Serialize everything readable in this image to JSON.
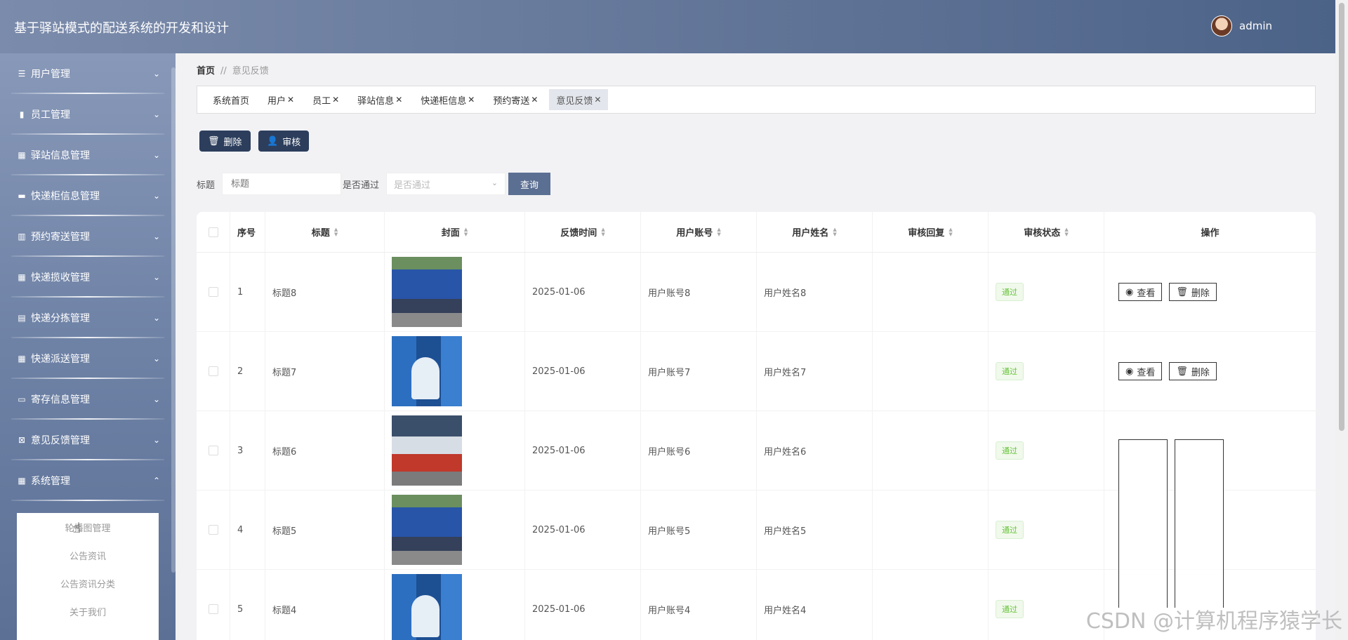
{
  "header": {
    "title": "基于驿站模式的配送系统的开发和设计",
    "username": "admin"
  },
  "sidebar": {
    "items": [
      {
        "label": "用户管理",
        "icon": "list-icon",
        "glyph": "☰",
        "chev": "⌄"
      },
      {
        "label": "员工管理",
        "icon": "clipboard-icon",
        "glyph": "▮",
        "chev": "⌄"
      },
      {
        "label": "驿站信息管理",
        "icon": "grid-icon",
        "glyph": "▦",
        "chev": "⌄"
      },
      {
        "label": "快递柜信息管理",
        "icon": "ticket-icon",
        "glyph": "▬",
        "chev": "⌄"
      },
      {
        "label": "预约寄送管理",
        "icon": "bar-chart-icon",
        "glyph": "▥",
        "chev": "⌄"
      },
      {
        "label": "快递揽收管理",
        "icon": "grid-icon",
        "glyph": "▦",
        "chev": "⌄"
      },
      {
        "label": "快递分拣管理",
        "icon": "printer-icon",
        "glyph": "▤",
        "chev": "⌄"
      },
      {
        "label": "快递派送管理",
        "icon": "grid-icon",
        "glyph": "▦",
        "chev": "⌄"
      },
      {
        "label": "寄存信息管理",
        "icon": "chat-icon",
        "glyph": "▭",
        "chev": "⌄"
      },
      {
        "label": "意见反馈管理",
        "icon": "close-box-icon",
        "glyph": "⊠",
        "chev": "⌄"
      },
      {
        "label": "系统管理",
        "icon": "grid-icon",
        "glyph": "▦",
        "chev": "⌃"
      }
    ],
    "submenu": [
      "轮播图管理",
      "公告资讯",
      "公告资讯分类",
      "关于我们"
    ]
  },
  "breadcrumb": {
    "home": "首页",
    "sep": "//",
    "current": "意见反馈"
  },
  "tabs": [
    {
      "label": "系统首页",
      "closable": ""
    },
    {
      "label": "用户",
      "closable": "✕"
    },
    {
      "label": "员工",
      "closable": "✕"
    },
    {
      "label": "驿站信息",
      "closable": "✕"
    },
    {
      "label": "快递柜信息",
      "closable": "✕"
    },
    {
      "label": "预约寄送",
      "closable": "✕"
    },
    {
      "label": "意见反馈",
      "closable": "✕"
    }
  ],
  "toolbar": {
    "delete_label": "删除",
    "audit_label": "审核",
    "delete_icon": "🗑",
    "audit_icon": "👤"
  },
  "search": {
    "title_label": "标题",
    "title_placeholder": "标题",
    "pass_label": "是否通过",
    "pass_placeholder": "是否通过",
    "query_label": "查询"
  },
  "table": {
    "headers": {
      "idx": "序号",
      "title": "标题",
      "cover": "封面",
      "time": "反馈时间",
      "account": "用户账号",
      "name": "用户姓名",
      "reply": "审核回复",
      "status": "审核状态",
      "ops": "操作"
    },
    "view_label": "查看",
    "delete_label": "删除",
    "rows": [
      {
        "idx": "1",
        "title": "标题8",
        "time": "2025-01-06",
        "account": "用户账号8",
        "name": "用户姓名8",
        "reply": "",
        "status": "通过"
      },
      {
        "idx": "2",
        "title": "标题7",
        "time": "2025-01-06",
        "account": "用户账号7",
        "name": "用户姓名7",
        "reply": "",
        "status": "通过"
      },
      {
        "idx": "3",
        "title": "标题6",
        "time": "2025-01-06",
        "account": "用户账号6",
        "name": "用户姓名6",
        "reply": "",
        "status": "通过"
      },
      {
        "idx": "4",
        "title": "标题5",
        "time": "2025-01-06",
        "account": "用户账号5",
        "name": "用户姓名5",
        "reply": "",
        "status": "通过"
      },
      {
        "idx": "5",
        "title": "标题4",
        "time": "2025-01-06",
        "account": "用户账号4",
        "name": "用户姓名4",
        "reply": "",
        "status": "通过"
      }
    ]
  },
  "watermark": "CSDN @计算机程序猿学长"
}
